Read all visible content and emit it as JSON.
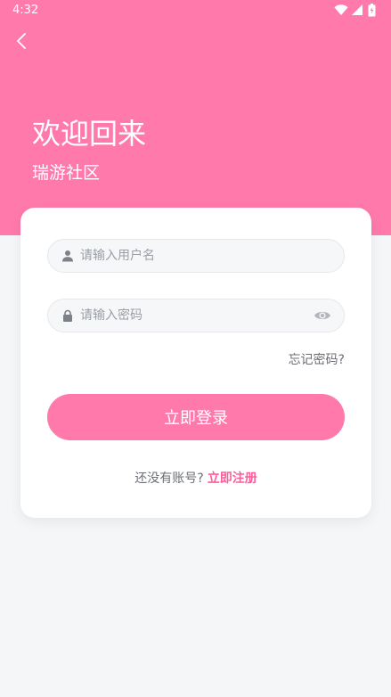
{
  "status_bar": {
    "time": "4:32",
    "icons": [
      "wifi-icon",
      "signal-icon",
      "battery-icon"
    ]
  },
  "header": {
    "back_icon": "chevron-left-icon",
    "title": "欢迎回来",
    "subtitle": "瑞游社区"
  },
  "form": {
    "username": {
      "value": "",
      "placeholder": "请输入用户名",
      "icon": "user-icon"
    },
    "password": {
      "value": "",
      "placeholder": "请输入密码",
      "icon": "lock-icon",
      "toggle_icon": "eye-icon"
    },
    "forgot_label": "忘记密码?",
    "login_label": "立即登录",
    "register_prompt": "还没有账号?",
    "register_label": "立即注册"
  },
  "colors": {
    "brand": "#ff7aab",
    "link": "#ff5c9a",
    "background": "#f5f6f8"
  }
}
